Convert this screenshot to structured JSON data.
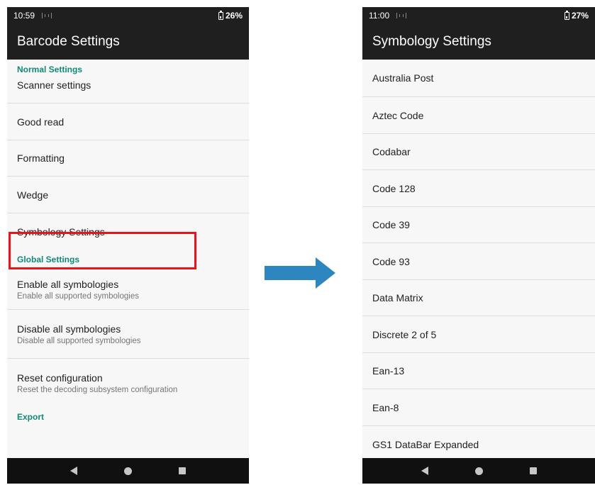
{
  "left_screen": {
    "status": {
      "time": "10:59",
      "battery": "26%"
    },
    "app_title": "Barcode Settings",
    "normal_header": "Normal Settings",
    "normal_items": [
      {
        "title": "Scanner settings"
      },
      {
        "title": "Good read"
      },
      {
        "title": "Formatting"
      },
      {
        "title": "Wedge"
      },
      {
        "title": "Symbology Settings"
      }
    ],
    "global_header": "Global Settings",
    "global_items": [
      {
        "title": "Enable all symbologies",
        "subtitle": "Enable all supported symbologies"
      },
      {
        "title": "Disable all symbologies",
        "subtitle": "Disable all supported symbologies"
      },
      {
        "title": "Reset configuration",
        "subtitle": "Reset the decoding subsystem configuration"
      }
    ],
    "cut_off_header": "Export"
  },
  "right_screen": {
    "status": {
      "time": "11:00",
      "battery": "27%"
    },
    "app_title": "Symbology Settings",
    "items": [
      "Australia Post",
      "Aztec Code",
      "Codabar",
      "Code 128",
      "Code 39",
      "Code 93",
      "Data Matrix",
      "Discrete 2 of 5",
      "Ean-13",
      "Ean-8",
      "GS1 DataBar Expanded"
    ]
  },
  "colors": {
    "accent": "#128a77",
    "highlight": "#e8141a",
    "arrow": "#2e86c1",
    "bar": "#1f1f1f"
  }
}
